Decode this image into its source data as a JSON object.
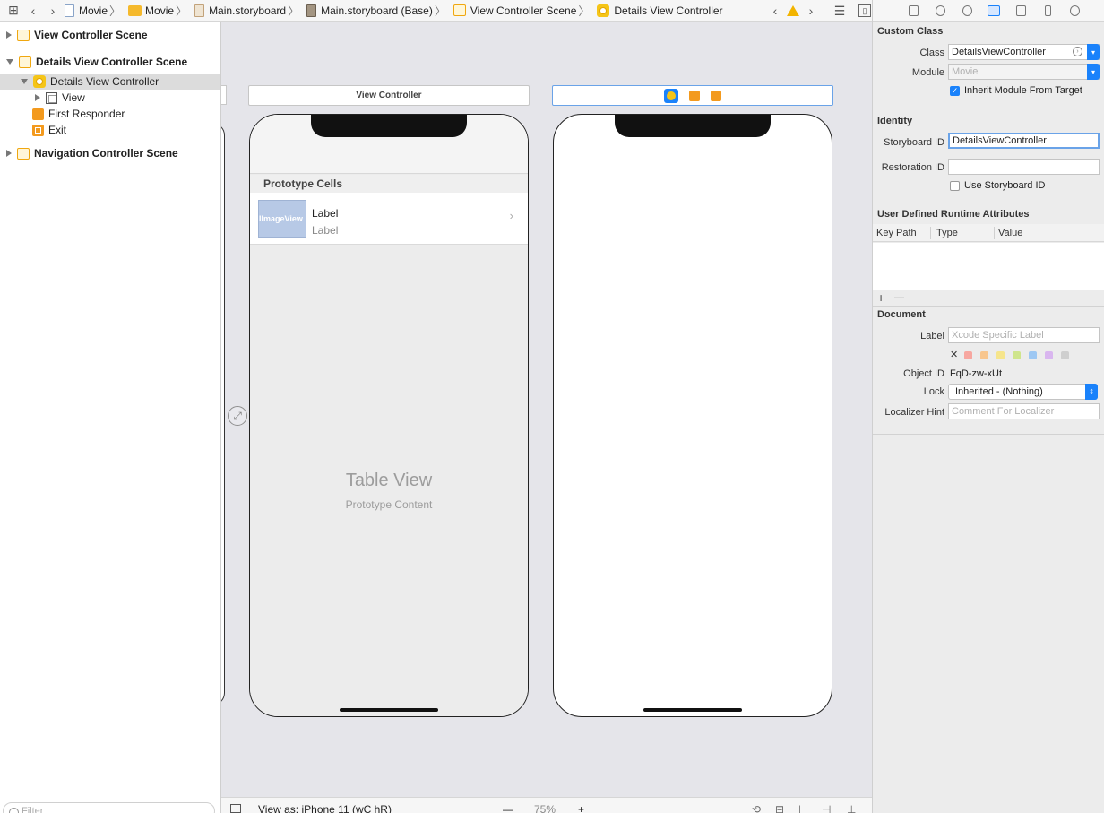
{
  "jumpbar": {
    "crumbs": [
      "Movie",
      "Movie",
      "Main.storyboard",
      "Main.storyboard (Base)",
      "View Controller Scene",
      "Details View Controller"
    ]
  },
  "outline": {
    "items": [
      {
        "label": "View Controller Scene"
      },
      {
        "label": "Details View Controller Scene"
      },
      {
        "label": "Details View Controller"
      },
      {
        "label": "View"
      },
      {
        "label": "First Responder"
      },
      {
        "label": "Exit"
      },
      {
        "label": "Navigation Controller Scene"
      }
    ],
    "filter_placeholder": "Filter"
  },
  "canvas": {
    "scene1_title": "View Controller",
    "prototype_header": "Prototype Cells",
    "cell_image_text": "lImageView",
    "cell_title": "Label",
    "cell_subtitle": "Label",
    "tableview_title": "Table View",
    "tableview_subtitle": "Prototype Content"
  },
  "bottombar": {
    "view_as": "View as: iPhone 11 (wC hR)",
    "zoom_minus": "—",
    "zoom": "75%",
    "zoom_plus": "+"
  },
  "inspector": {
    "custom_class": {
      "title": "Custom Class",
      "class_label": "Class",
      "class_value": "DetailsViewController",
      "module_label": "Module",
      "module_placeholder": "Movie",
      "inherit_label": "Inherit Module From Target"
    },
    "identity": {
      "title": "Identity",
      "storyboard_id_label": "Storyboard ID",
      "storyboard_id_value": "DetailsViewController",
      "restoration_id_label": "Restoration ID",
      "use_storyboard_label": "Use Storyboard ID"
    },
    "runtime": {
      "title": "User Defined Runtime Attributes",
      "col_keypath": "Key Path",
      "col_type": "Type",
      "col_value": "Value",
      "add": "+",
      "remove": "—"
    },
    "document": {
      "title": "Document",
      "label_label": "Label",
      "label_placeholder": "Xcode Specific Label",
      "clear": "✕",
      "swatch_colors": [
        "#f7a7a0",
        "#f8c68e",
        "#f6e58c",
        "#cfe58c",
        "#9ec8f3",
        "#d9b6ef",
        "#cfcfcf"
      ],
      "object_id_label": "Object ID",
      "object_id_value": "FqD-zw-xUt",
      "lock_label": "Lock",
      "lock_value": "Inherited - (Nothing)",
      "localizer_label": "Localizer Hint",
      "localizer_placeholder": "Comment For Localizer"
    }
  }
}
